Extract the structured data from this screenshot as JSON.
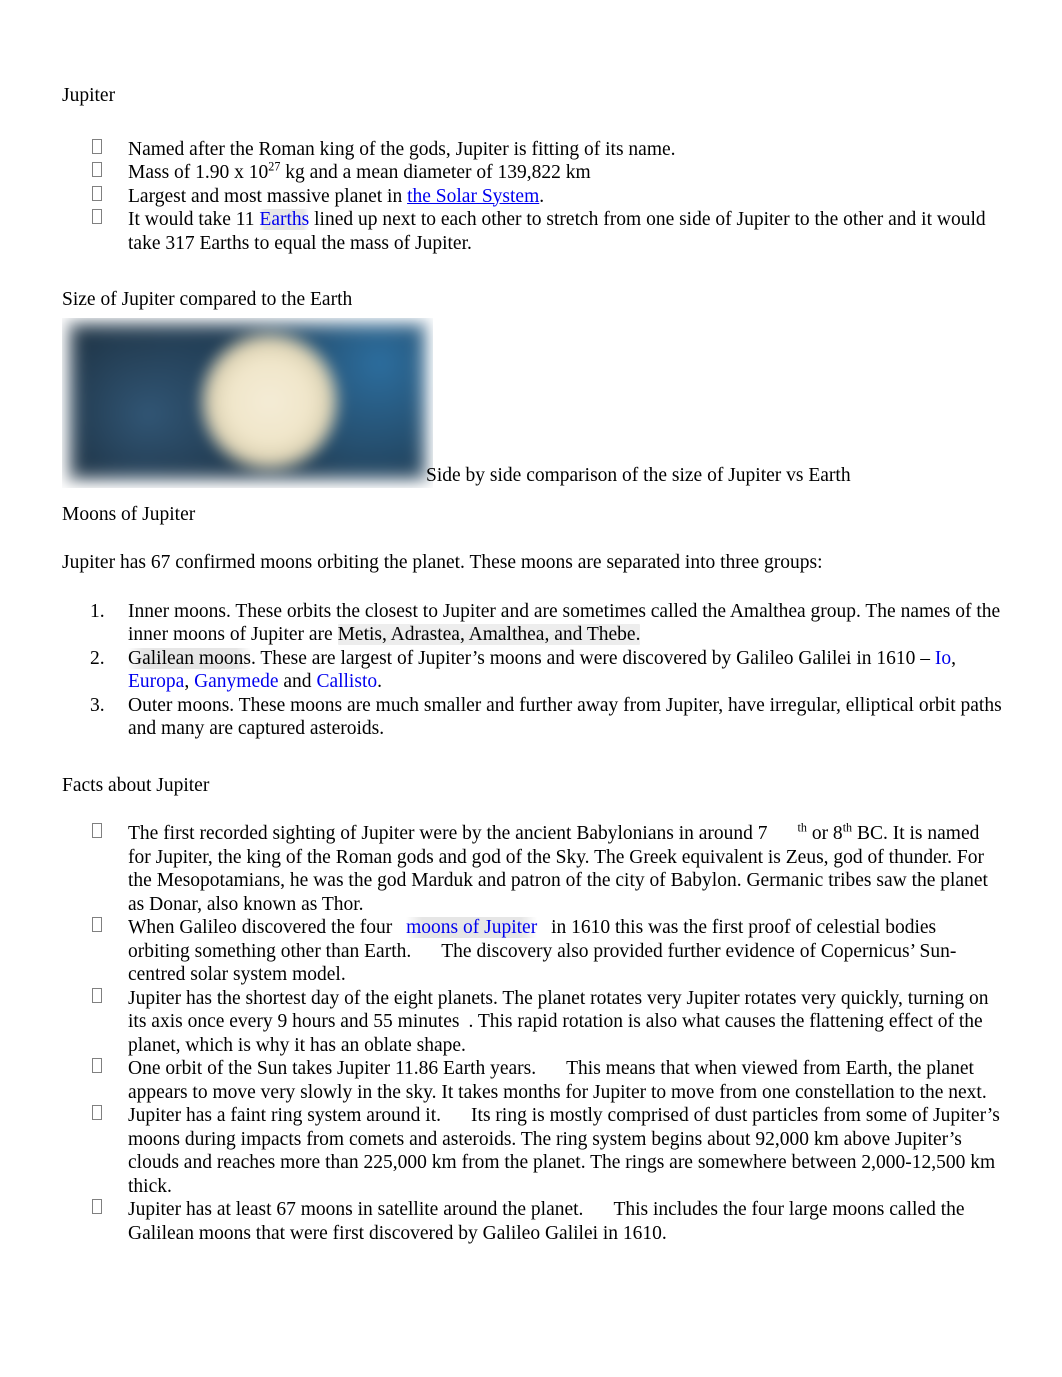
{
  "document": {
    "title": "Jupiter",
    "intro_bullets": [
      {
        "id": "bullet-named-after",
        "pre": "Named after the Roman king of the gods, Jupiter is fitting of its name.",
        "link": "",
        "post": ""
      },
      {
        "id": "bullet-mass",
        "pre": "Mass of 1.90 x 10",
        "sup": "27",
        "post": " kg and a mean diameter of 139,822 km"
      },
      {
        "id": "bullet-largest",
        "pre": "Largest and most massive planet in ",
        "link": "the Solar System",
        "post": "."
      },
      {
        "id": "bullet-eleven-earths",
        "pre": "It would take 11 ",
        "link": "Earths",
        "post": " lined up next to each other to stretch from one side of Jupiter to the other and it would take 317 Earths to equal the mass of Jupiter."
      }
    ],
    "size_heading": "Size of Jupiter compared to the Earth",
    "figure": {
      "alt": "jupiter-earth-size-comparison-image",
      "caption": "Side by side comparison of the size of Jupiter vs Earth"
    },
    "moons_heading": "Moons of Jupiter",
    "moons_intro": "Jupiter has 67 confirmed moons orbiting the planet. These moons are separated into three groups:",
    "moons_list": [
      {
        "number": "1.",
        "text_a": "Inner  moons. These orbits the closest to Jupiter and are sometimes called the Amalthea group. The names of the inner moons of Jupiter are ",
        "shaded": "Metis, Adrastea, Amalthea, and Thebe.",
        "text_b": ""
      },
      {
        "number": "2.",
        "text_a": "Galilean  moons",
        "text_b": ". These are largest  of Jupiter’s moons and were discovered by Galileo Galilei in 1610 – ",
        "links": [
          "Io",
          "Europa",
          "Ganymede",
          "Callisto"
        ],
        "sep1": ", ",
        "sep2": ", ",
        "sep3": " and ",
        "tail": "."
      },
      {
        "number": "3.",
        "text_a": "Outer  moons",
        "text_b": ". These moons are much smaller  and further   away from Jupiter, have irregular, elliptical orbit paths and many are captured asteroids."
      }
    ],
    "facts_heading": "Facts about Jupiter",
    "facts_bullets": [
      {
        "id": "fact-first-sighting",
        "seg1": "The first recorded sighting of Jupiter were by the ancient Babylonians in around 7",
        "sup1": "th",
        "seg2": " or 8",
        "sup2": "th",
        "seg3": " BC. It is named for Jupiter, the king of the Roman gods and god of the Sky. The Greek equivalent is Zeus, god of thunder. For the Mesopotamians, he was the god Marduk and patron of the city of Babylon. Germanic tribes saw the planet as Donar, also known as Thor."
      },
      {
        "id": "fact-galileo-moons",
        "seg1": "When Galileo discovered the four ",
        "link": "moons of Jupiter",
        "seg2": " in 1610 this was the first proof of celestial bodies orbiting something other than Earth.",
        "seg3": "The discovery also provided further evidence of Copernicus’ Sun-centred solar system model."
      },
      {
        "id": "fact-shortest-day",
        "seg1": "Jupiter has the shortest  day",
        "seg2": " of the eight planets. The planet rotates very Jupiter rotates very quickly, turning on its axis once every 9 hours and 55 minutes",
        "seg3": ". This rapid rotation is also what causes the flattening  effect",
        "seg4": " of the planet, which is why it has an oblate shape."
      },
      {
        "id": "fact-orbit-period",
        "seg1": "One orbit of the Sun takes Jupiter 11.86 Earth years.",
        "seg2": "This means that when viewed from Earth, the planet appears to move very slowly in the sky. It takes months for Jupiter to move from one constellation to the next."
      },
      {
        "id": "fact-ring-system",
        "seg1": "Jupiter has a faint ring system around it.",
        "seg2": "Its ring is mostly comprised of dust particles from some of Jupiter’s moons during impacts from comets and asteroids. The ring system begins about 92,000 km above Jupiter’s clouds and reaches more than 225,000 km from the planet. The rings are somewhere between 2,000-12,500 km thick."
      },
      {
        "id": "fact-67-moons",
        "seg1": "Jupiter has at least 67 moons in satellite around the planet.",
        "seg2": "This includes the four large moons called the Galilean moons that were first discovered by Galileo Galilei in 1610."
      }
    ]
  },
  "colors": {
    "link": "#0000EE",
    "text": "#000000",
    "page_background": "#FFFFFF",
    "highlight": "#EDEDED"
  }
}
